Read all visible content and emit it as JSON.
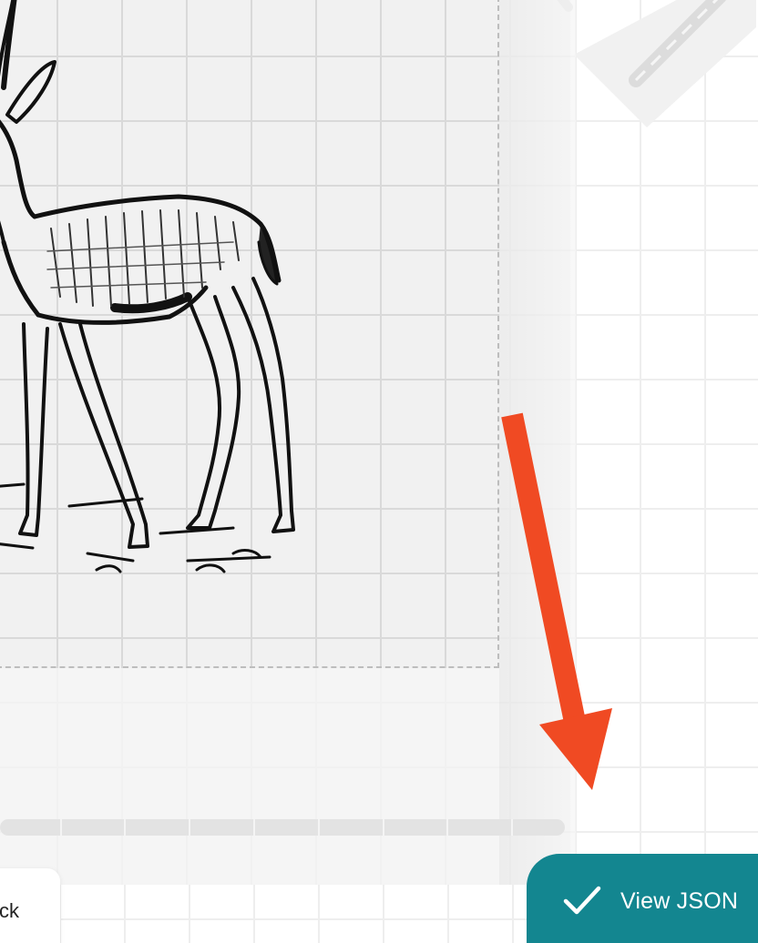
{
  "colors": {
    "accent_button": "#138690",
    "arrow": "#f04a23",
    "frame_dash": "#bdbdbd"
  },
  "canvas": {
    "image_subject": "antelope-illustration"
  },
  "footer": {
    "back_label": "ck",
    "view_json_label": "View JSON",
    "view_json_icon": "check-icon"
  },
  "annotation": {
    "icon": "red-arrow-pointing-down"
  }
}
